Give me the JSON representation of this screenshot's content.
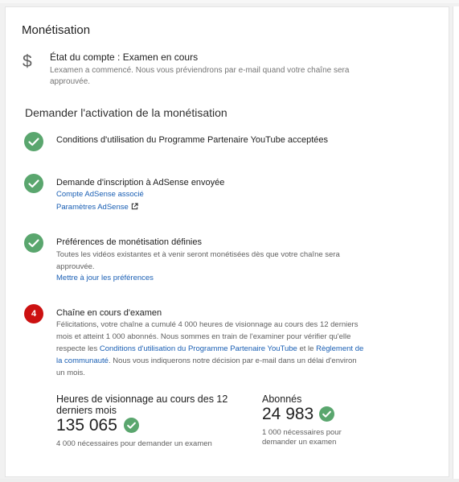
{
  "card": {
    "title": "Monétisation",
    "account": {
      "icon": "dollar-icon",
      "status": "État du compte : Examen en cours",
      "description": "Lexamen a commencé. Nous vous préviendrons par e-mail quand votre chaîne sera approuvée."
    },
    "section_title": "Demander l'activation de la monétisation",
    "steps": [
      {
        "state": "done",
        "icon": "check-icon",
        "title": "Conditions d'utilisation du Programme Partenaire YouTube acceptées"
      },
      {
        "state": "done",
        "icon": "check-icon",
        "title": "Demande d'inscription à AdSense envoyée",
        "link1": "Compte AdSense associé",
        "link2": "Paramètres AdSense",
        "link2_icon": "external-link-icon"
      },
      {
        "state": "done",
        "icon": "check-icon",
        "title": "Préférences de monétisation définies",
        "text": "Toutes les vidéos existantes et à venir seront monétisées dès que votre chaîne sera approuvée.",
        "link": "Mettre à jour les préférences"
      },
      {
        "state": "in-progress",
        "number": "4",
        "title": "Chaîne en cours d'examen",
        "text_part1": "Félicitations, votre chaîne a cumulé 4 000 heures de visionnage au cours des 12 derniers mois et atteint 1 000 abonnés. Nous sommes en train de l'examiner pour vérifier qu'elle respecte les ",
        "link_terms": "Conditions d'utilisation du Programme Partenaire YouTube",
        "text_part2": " et le ",
        "link_rules": "Règlement de la communauté",
        "text_part3": ". Nous vous indiquerons notre décision par e-mail dans un délai d'environ un mois."
      }
    ],
    "metrics": {
      "watch_hours": {
        "label": "Heures de visionnage au cours des 12 derniers mois",
        "value": "135 065",
        "requirement": "4 000 nécessaires pour demander un examen"
      },
      "subscribers": {
        "label": "Abonnés",
        "value": "24 983",
        "requirement": "1 000 nécessaires pour demander un examen"
      }
    }
  },
  "colors": {
    "success": "#5aa66e",
    "alert": "#cc1111",
    "link": "#1a5fb4"
  }
}
